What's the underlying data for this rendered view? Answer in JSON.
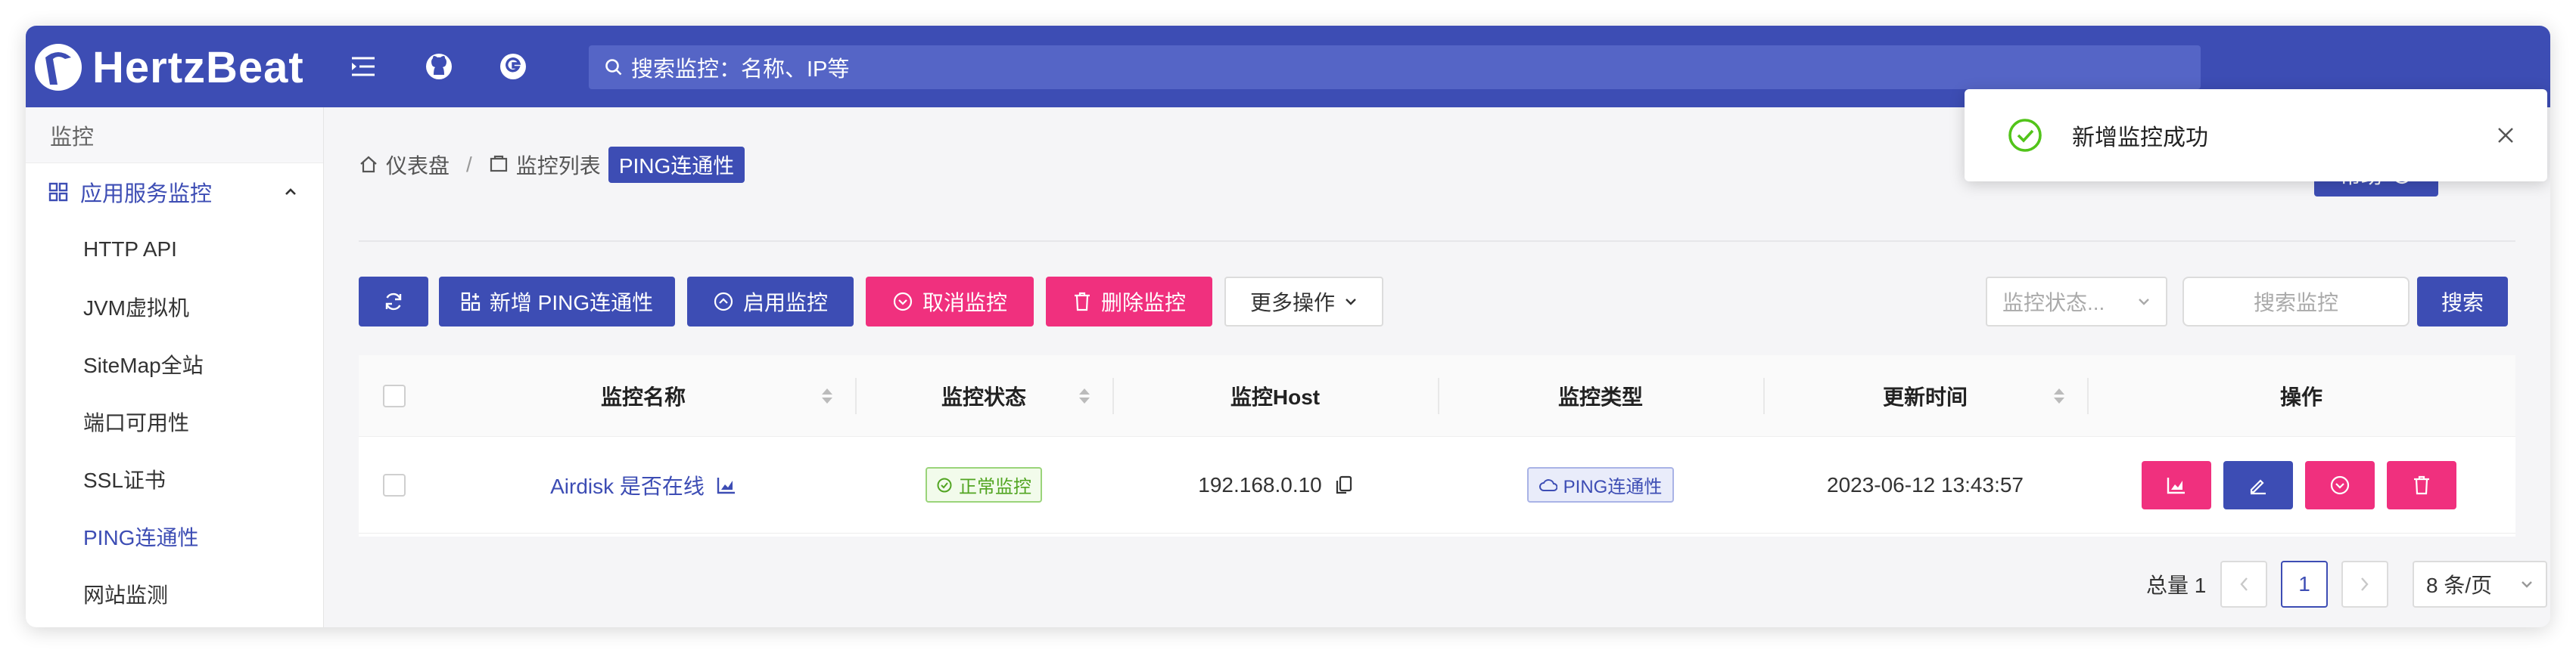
{
  "header": {
    "logo_text": "HertzBeat",
    "search_placeholder": "搜索监控：名称、IP等"
  },
  "sidebar": {
    "root_label": "监控",
    "group_label": "应用服务监控",
    "items": [
      {
        "label": "HTTP API"
      },
      {
        "label": "JVM虚拟机"
      },
      {
        "label": "SiteMap全站"
      },
      {
        "label": "端口可用性"
      },
      {
        "label": "SSL证书"
      },
      {
        "label": "PING连通性"
      },
      {
        "label": "网站监测"
      }
    ]
  },
  "breadcrumb": {
    "home": "仪表盘",
    "separator": "/",
    "list": "监控列表",
    "current": "PING连通性"
  },
  "help_label": "帮助",
  "toolbar": {
    "add_label": "新增 PING连通性",
    "enable_label": "启用监控",
    "cancel_label": "取消监控",
    "delete_label": "删除监控",
    "more_label": "更多操作",
    "status_placeholder": "监控状态...",
    "search_placeholder": "搜索监控",
    "search_button": "搜索"
  },
  "table": {
    "columns": [
      "监控名称",
      "监控状态",
      "监控Host",
      "监控类型",
      "更新时间",
      "操作"
    ],
    "rows": [
      {
        "name": "Airdisk 是否在线",
        "status": "正常监控",
        "host": "192.168.0.10",
        "type": "PING连通性",
        "updated": "2023-06-12 13:43:57"
      }
    ]
  },
  "pagination": {
    "total_label": "总量 1",
    "current_page": "1",
    "page_size": "8 条/页"
  },
  "toast": {
    "message": "新增监控成功"
  },
  "colors": {
    "primary": "#3d4db4",
    "danger": "#f0307e",
    "success": "#52c41a"
  }
}
